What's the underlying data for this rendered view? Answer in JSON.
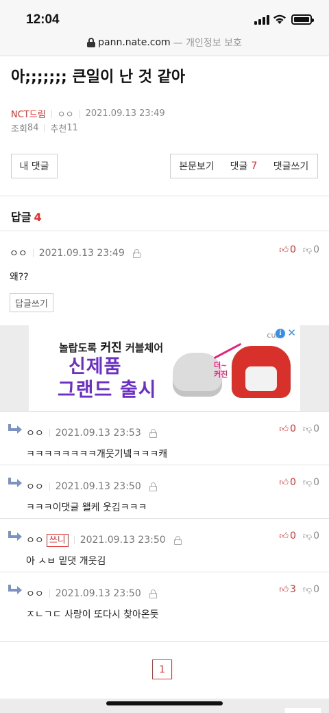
{
  "status_bar": {
    "time": "12:04"
  },
  "url_bar": {
    "domain": "pann.nate.com",
    "privacy": "— 개인정보 보호"
  },
  "post": {
    "title": "아;;;;;;; 큰일이 난 것 같아",
    "category": "NCT드림",
    "author": "ㅇㅇ",
    "datetime": "2021.09.13 23:49",
    "views_label": "조회",
    "views": "84",
    "recommend_label": "추천",
    "recommend": "11"
  },
  "buttons": {
    "my_comments": "내 댓글",
    "view_body": "본문보기",
    "comments_label": "댓글",
    "comments_count": "7",
    "write_comment": "댓글쓰기"
  },
  "replies_header": {
    "label": "답글",
    "count": "4"
  },
  "main_comment": {
    "nick": "ㅇㅇ",
    "datetime": "2021.09.13 23:49",
    "text": "왜??",
    "up": "0",
    "down": "0",
    "reply_button": "답글쓰기"
  },
  "ad": {
    "line1": "놀랍도록",
    "line1_brand": "커진",
    "line1_tail": "커블체어",
    "line2": "신제품",
    "line3": "그랜드 출시",
    "brand": "curl",
    "more": "더~\n커진"
  },
  "replies": [
    {
      "nick": "ㅇㅇ",
      "badge": "",
      "datetime": "2021.09.13 23:53",
      "text": "ㅋㅋㅋㅋㅋㅋㅋㅋ개웃기넼ㅋㅋㅋ캐",
      "up": "0",
      "down": "0"
    },
    {
      "nick": "ㅇㅇ",
      "badge": "",
      "datetime": "2021.09.13 23:50",
      "text": "ㅋㅋㅋ이댓글 왤케 웃김ㅋㅋㅋ",
      "up": "0",
      "down": "0"
    },
    {
      "nick": "ㅇㅇ",
      "badge": "쓰니",
      "datetime": "2021.09.13 23:50",
      "text": "아 ㅅㅂ 밑댓 개웃김",
      "up": "0",
      "down": "0"
    },
    {
      "nick": "ㅇㅇ",
      "badge": "",
      "datetime": "2021.09.13 23:50",
      "text": "ㅈㄴㄱㄷ 사랑이 또다시 찾아온듯",
      "up": "3",
      "down": "0"
    }
  ],
  "pagination": {
    "current": "1"
  },
  "colors": {
    "accent_red": "#e0302f",
    "reply_arrow": "#7b93c2",
    "ad_purple": "#6a2fc4"
  }
}
